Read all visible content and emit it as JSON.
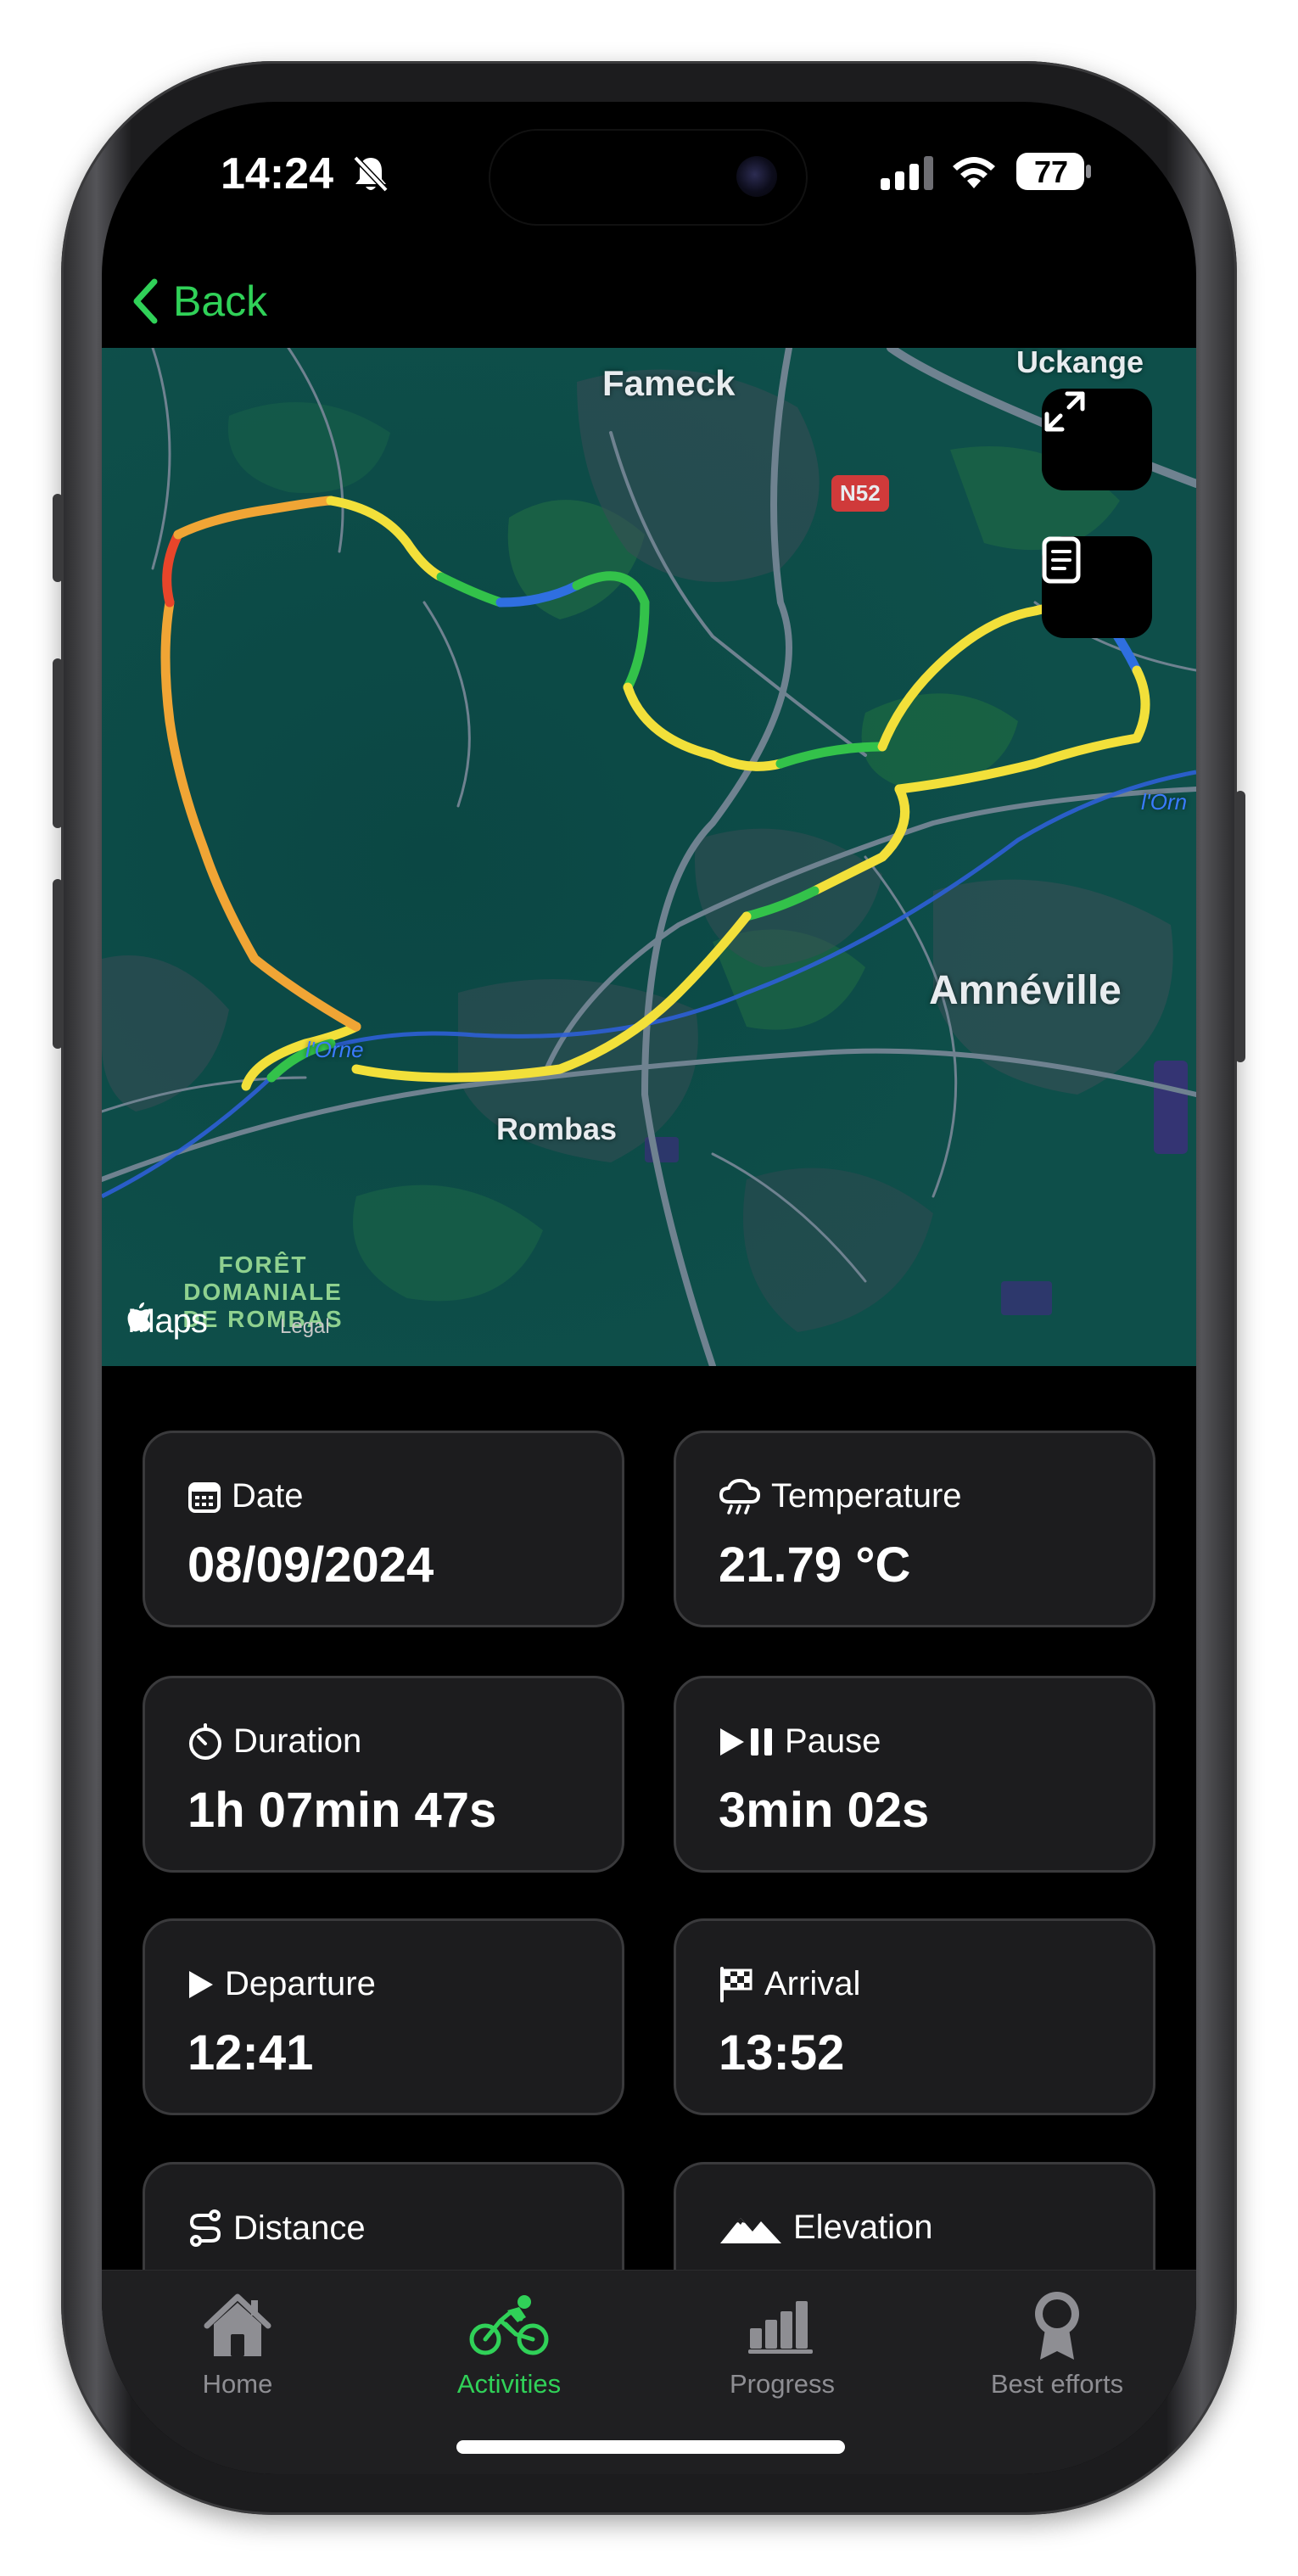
{
  "status_bar": {
    "time": "14:24",
    "battery": "77",
    "icons": [
      "bell-slash-icon",
      "signal-icon",
      "wifi-icon",
      "battery-icon"
    ]
  },
  "nav": {
    "back_label": "Back"
  },
  "map": {
    "places": {
      "fameck": "Fameck",
      "uckange": "Uckange",
      "amneville": "Amnéville",
      "rombas": "Rombas",
      "road": "N52",
      "river_left": "l'Orne",
      "river_right": "l'Orn",
      "forest_line1": "FORÊT",
      "forest_line2": "DOMANIALE",
      "forest_line3": "DE ROMBAS"
    },
    "attribution": "Maps",
    "legal": "Legal",
    "buttons": [
      "expand-icon",
      "document-icon"
    ]
  },
  "cards": [
    {
      "label": "Date",
      "value": "08/09/2024",
      "icon": "calendar-icon"
    },
    {
      "label": "Temperature",
      "value": "21.79 °C",
      "icon": "cloud-rain-icon"
    },
    {
      "label": "Duration",
      "value": "1h 07min 47s",
      "icon": "timer-icon"
    },
    {
      "label": "Pause",
      "value": "3min 02s",
      "icon": "play-pause-icon"
    },
    {
      "label": "Departure",
      "value": "12:41",
      "icon": "play-icon"
    },
    {
      "label": "Arrival",
      "value": "13:52",
      "icon": "checkered-flag-icon"
    },
    {
      "label": "Distance",
      "value": "",
      "icon": "route-icon"
    },
    {
      "label": "Elevation",
      "value": "",
      "icon": "mountains-icon"
    }
  ],
  "tab_bar": {
    "tabs": [
      {
        "label": "Home",
        "icon": "house-icon",
        "active": false
      },
      {
        "label": "Activities",
        "icon": "bicycle-icon",
        "active": true
      },
      {
        "label": "Progress",
        "icon": "bar-chart-icon",
        "active": false
      },
      {
        "label": "Best efforts",
        "icon": "medal-icon",
        "active": false
      }
    ]
  },
  "colors": {
    "accent": "#30d158",
    "card_background": "#1c1c1e",
    "screen_background": "#000000",
    "route_slow": "#2f6fe0",
    "route_medium": "#33c24a",
    "route_fast": "#f2e03a",
    "route_fastest": "#e8452a"
  }
}
